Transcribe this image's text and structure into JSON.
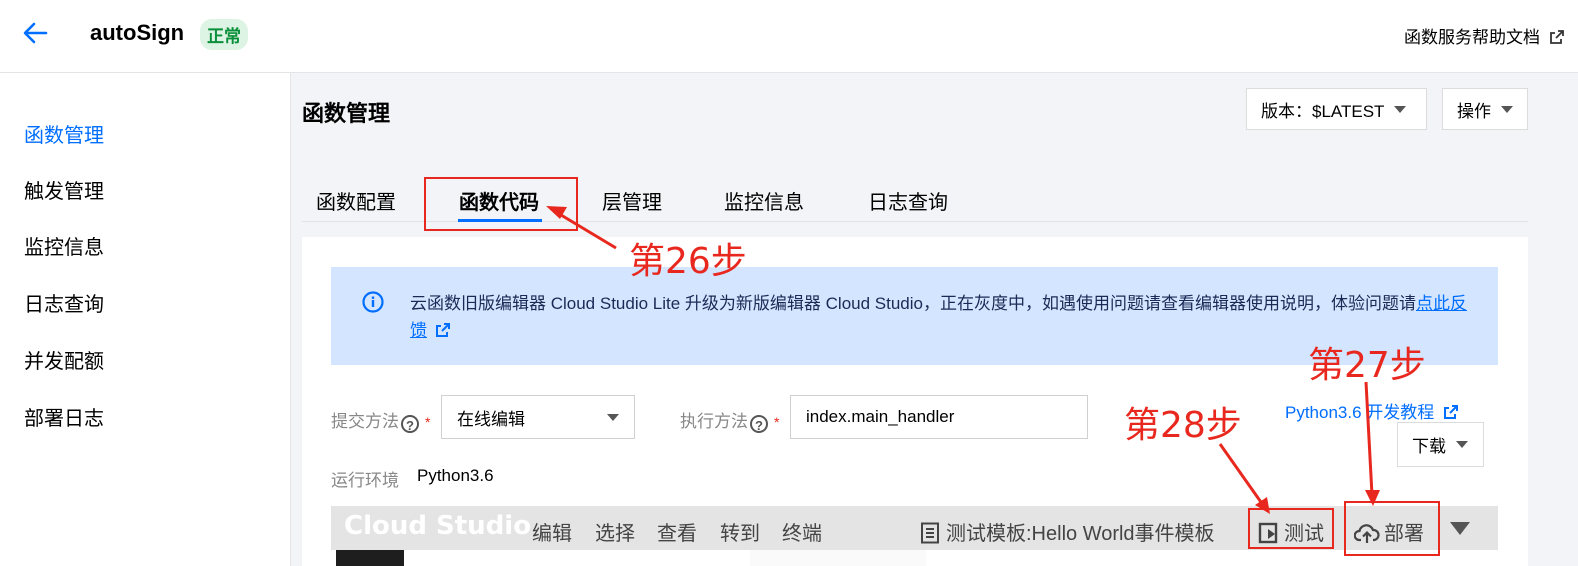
{
  "header": {
    "app_name": "autoSign",
    "status": "正常",
    "help_link": "函数服务帮助文档"
  },
  "sidebar": {
    "items": [
      {
        "label": "函数管理"
      },
      {
        "label": "触发管理"
      },
      {
        "label": "监控信息"
      },
      {
        "label": "日志查询"
      },
      {
        "label": "并发配额"
      },
      {
        "label": "部署日志"
      }
    ]
  },
  "main": {
    "title": "函数管理",
    "version_button": "版本：$LATEST",
    "actions_button": "操作",
    "tabs": [
      {
        "label": "函数配置"
      },
      {
        "label": "函数代码"
      },
      {
        "label": "层管理"
      },
      {
        "label": "监控信息"
      },
      {
        "label": "日志查询"
      }
    ]
  },
  "annotations": {
    "step26": "第26步",
    "step27": "第27步",
    "step28": "第28步",
    "color": "#e8281e"
  },
  "info_banner": {
    "text": "云函数旧版编辑器 Cloud Studio Lite 升级为新版编辑器 Cloud Studio，正在灰度中，如遇使用问题请查看编辑器使用说明，体验问题请",
    "link": "点此反馈"
  },
  "form": {
    "submit_label": "提交方法",
    "submit_value": "在线编辑",
    "exec_label": "执行方法",
    "exec_value": "index.main_handler",
    "runtime_label": "运行环境",
    "runtime_value": "Python3.6",
    "tutorial_link": "Python3.6 开发教程",
    "download_button": "下载"
  },
  "cloud_studio": {
    "logo": "Cloud Studio",
    "menu": [
      "编辑",
      "选择",
      "查看",
      "转到",
      "终端"
    ],
    "test_template": "测试模板:Hello World事件模板",
    "test_button": "测试",
    "deploy_button": "部署"
  },
  "colors": {
    "accent": "#006eff",
    "badge_bg": "#ddf3e3",
    "badge_text": "#0a8f3a",
    "banner_bg": "#d3e5ff"
  }
}
